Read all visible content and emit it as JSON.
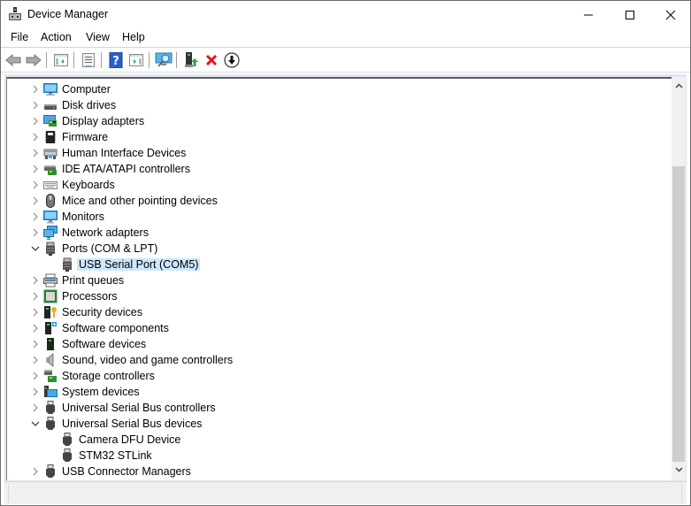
{
  "window": {
    "title": "Device Manager",
    "controls": {
      "minimize": "minimize",
      "maximize": "maximize",
      "close": "close"
    }
  },
  "menu": [
    "File",
    "Action",
    "View",
    "Help"
  ],
  "toolbar": [
    {
      "name": "back-icon",
      "tooltip": "Back"
    },
    {
      "name": "forward-icon",
      "tooltip": "Forward"
    },
    {
      "name": "show-hide-console-tree-icon",
      "tooltip": "Show/Hide Console Tree"
    },
    {
      "name": "properties-icon",
      "tooltip": "Properties"
    },
    {
      "name": "help-icon",
      "tooltip": "Help"
    },
    {
      "name": "show-hide-action-pane-icon",
      "tooltip": "Show/Hide Action Pane"
    },
    {
      "name": "scan-hardware-icon",
      "tooltip": "Scan for hardware changes"
    },
    {
      "name": "update-driver-icon",
      "tooltip": "Update driver"
    },
    {
      "name": "uninstall-device-icon",
      "tooltip": "Uninstall device"
    },
    {
      "name": "disable-device-icon",
      "tooltip": "Disable device"
    }
  ],
  "tree": [
    {
      "label": "Computer",
      "icon": "computer-icon",
      "level": 0,
      "expanded": false
    },
    {
      "label": "Disk drives",
      "icon": "disk-drive-icon",
      "level": 0,
      "expanded": false
    },
    {
      "label": "Display adapters",
      "icon": "display-adapter-icon",
      "level": 0,
      "expanded": false
    },
    {
      "label": "Firmware",
      "icon": "firmware-icon",
      "level": 0,
      "expanded": false
    },
    {
      "label": "Human Interface Devices",
      "icon": "hid-icon",
      "level": 0,
      "expanded": false
    },
    {
      "label": "IDE ATA/ATAPI controllers",
      "icon": "ide-controller-icon",
      "level": 0,
      "expanded": false
    },
    {
      "label": "Keyboards",
      "icon": "keyboard-icon",
      "level": 0,
      "expanded": false
    },
    {
      "label": "Mice and other pointing devices",
      "icon": "mouse-icon",
      "level": 0,
      "expanded": false
    },
    {
      "label": "Monitors",
      "icon": "monitor-icon",
      "level": 0,
      "expanded": false
    },
    {
      "label": "Network adapters",
      "icon": "network-adapter-icon",
      "level": 0,
      "expanded": false
    },
    {
      "label": "Ports (COM & LPT)",
      "icon": "port-icon",
      "level": 0,
      "expanded": true
    },
    {
      "label": "USB Serial Port (COM5)",
      "icon": "port-icon",
      "level": 1,
      "selected": true
    },
    {
      "label": "Print queues",
      "icon": "printer-icon",
      "level": 0,
      "expanded": false
    },
    {
      "label": "Processors",
      "icon": "processor-icon",
      "level": 0,
      "expanded": false
    },
    {
      "label": "Security devices",
      "icon": "security-device-icon",
      "level": 0,
      "expanded": false
    },
    {
      "label": "Software components",
      "icon": "software-component-icon",
      "level": 0,
      "expanded": false
    },
    {
      "label": "Software devices",
      "icon": "software-device-icon",
      "level": 0,
      "expanded": false
    },
    {
      "label": "Sound, video and game controllers",
      "icon": "speaker-icon",
      "level": 0,
      "expanded": false
    },
    {
      "label": "Storage controllers",
      "icon": "storage-controller-icon",
      "level": 0,
      "expanded": false
    },
    {
      "label": "System devices",
      "icon": "system-device-icon",
      "level": 0,
      "expanded": false
    },
    {
      "label": "Universal Serial Bus controllers",
      "icon": "usb-icon",
      "level": 0,
      "expanded": false
    },
    {
      "label": "Universal Serial Bus devices",
      "icon": "usb-icon",
      "level": 0,
      "expanded": true
    },
    {
      "label": "Camera DFU Device",
      "icon": "usb-icon",
      "level": 1
    },
    {
      "label": "STM32 STLink",
      "icon": "usb-icon",
      "level": 1
    },
    {
      "label": "USB Connector Managers",
      "icon": "usb-icon",
      "level": 0,
      "expanded": false
    }
  ],
  "colors": {
    "selection": "#cce8ff",
    "scroll_thumb": "#cdcdcd",
    "accent_blue": "#1e90ff"
  }
}
